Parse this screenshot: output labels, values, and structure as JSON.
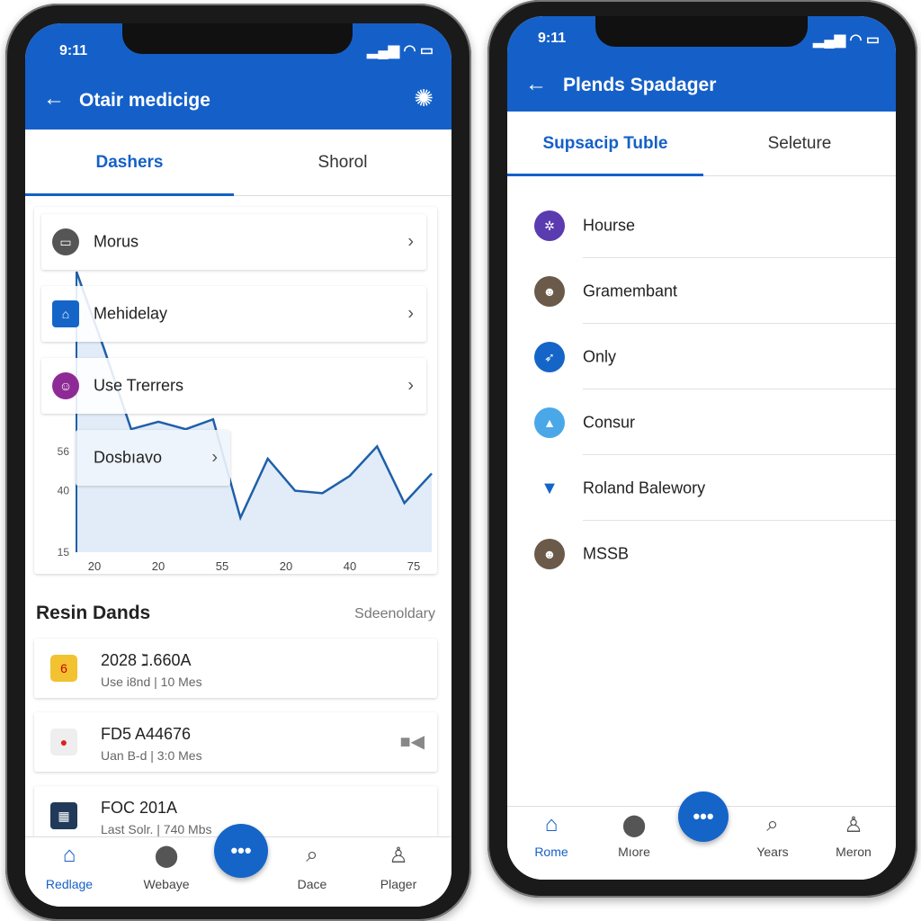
{
  "left": {
    "status_time": "9:11",
    "title": "Otair medicige",
    "tabs": [
      {
        "label": "Dashers",
        "active": true
      },
      {
        "label": "Shorol",
        "active": false
      }
    ],
    "menu": [
      {
        "label": "Morus",
        "icon": "monitor-icon",
        "color": "#555555"
      },
      {
        "label": "Mehidelay",
        "icon": "building-icon",
        "color": "#1565c8"
      },
      {
        "label": "Use Trerrers",
        "icon": "face-icon",
        "color": "#8e2a96"
      },
      {
        "label": "Dosbıavo"
      }
    ],
    "chart_data": {
      "type": "area",
      "x_tick_labels": [
        "20",
        "20",
        "55",
        "20",
        "40",
        "75"
      ],
      "y_tick_labels": [
        {
          "label": "56",
          "value": 56
        },
        {
          "label": "40",
          "value": 40
        },
        {
          "label": "15",
          "value": 15
        }
      ],
      "values": [
        129,
        98,
        65,
        68,
        65,
        69,
        29,
        53,
        40,
        39,
        46,
        58,
        35,
        47
      ],
      "ylim": [
        15,
        129
      ],
      "color": "#1f5fa8"
    },
    "section_title": "Resin Dands",
    "section_link": "Sdeenoldary",
    "downloads": [
      {
        "title": "2028 ℷ.660A",
        "sub": "Use i8nd | 10 Mes",
        "icon": "calendar-icon"
      },
      {
        "title": "FD5 A44676",
        "sub": "Uan B-d | 3:0 Mes",
        "icon": "record-icon",
        "action": "video-icon"
      },
      {
        "title": "FOC 201A",
        "sub": "Last Solr. | 740 Mbs",
        "icon": "screen-icon"
      }
    ],
    "nav": [
      {
        "label": "Redlage",
        "icon": "home-icon",
        "active": true
      },
      {
        "label": "Webaye",
        "icon": "location-pin-icon"
      },
      {
        "label": "Dace",
        "icon": "search-icon"
      },
      {
        "label": "Plager",
        "icon": "person-icon"
      }
    ],
    "fab": "•••"
  },
  "right": {
    "status_time": "9:11",
    "title": "Plends Spadager",
    "tabs": [
      {
        "label": "Supsacip Tuble",
        "active": true
      },
      {
        "label": "Seleture",
        "active": false
      }
    ],
    "items": [
      {
        "label": "Hourse",
        "color": "#5b3bb0"
      },
      {
        "label": "Gramembant",
        "color": "#6b5a4a"
      },
      {
        "label": "Only",
        "color": "#1565c8"
      },
      {
        "label": "Consur",
        "color": "#4aa8e8"
      },
      {
        "label": "Roland Balewory",
        "color": "#1565c8"
      },
      {
        "label": "MSSB",
        "color": "#6b5a4a"
      }
    ],
    "nav": [
      {
        "label": "Rome",
        "icon": "home-icon",
        "active": true
      },
      {
        "label": "Mıore",
        "icon": "location-pin-icon"
      },
      {
        "label": "Years",
        "icon": "search-icon"
      },
      {
        "label": "Meron",
        "icon": "person-icon"
      }
    ],
    "fab": "•••"
  },
  "accent": "#1560c8"
}
